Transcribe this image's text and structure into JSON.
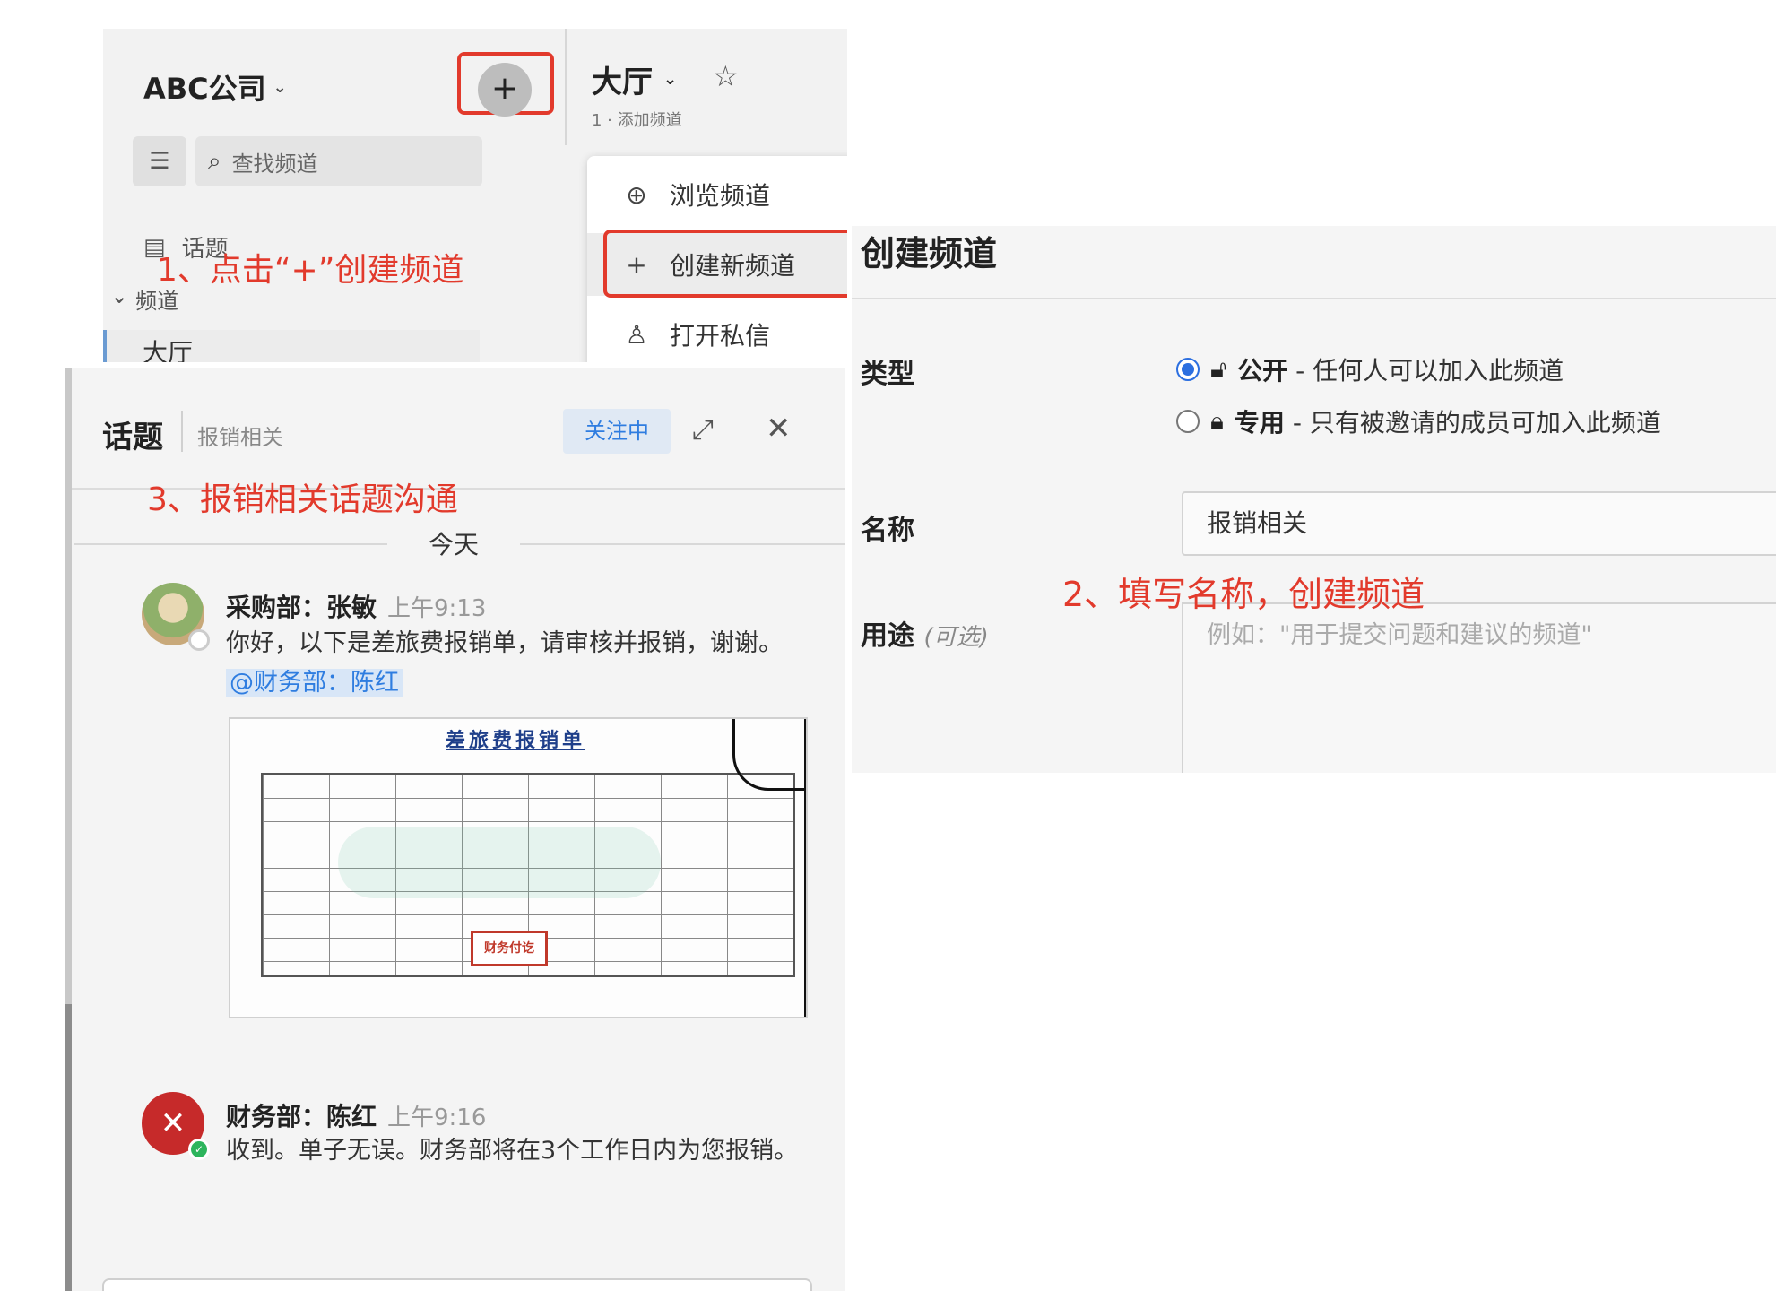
{
  "sidebar": {
    "company": "ABC公司",
    "search_placeholder": "查找频道",
    "topics_label": "话题",
    "section_label": "频道",
    "lobby_label": "大厅"
  },
  "channel_header": {
    "title": "大厅",
    "subinfo": "1 · 添加频道"
  },
  "add_menu": {
    "items": [
      {
        "label": "浏览频道",
        "icon": "globe-icon"
      },
      {
        "label": "创建新频道",
        "icon": "plus-icon"
      },
      {
        "label": "打开私信",
        "icon": "person-icon"
      }
    ]
  },
  "annotations": {
    "step1": "1、点击“+”创建频道",
    "step2": "2、填写名称，创建频道",
    "step3": "3、报销相关话题沟通"
  },
  "create_dialog": {
    "title": "创建频道",
    "type_label": "类型",
    "public_label": "公开",
    "public_desc": " - 任何人可以加入此频道",
    "private_label": "专用",
    "private_desc": " - 只有被邀请的成员可加入此频道",
    "selected_type": "公开",
    "name_label": "名称",
    "name_value": "报销相关",
    "purpose_label": "用途",
    "purpose_optional": "(可选)",
    "purpose_placeholder": "例如：\"用于提交问题和建议的频道\""
  },
  "thread": {
    "title": "话题",
    "subtitle": "报销相关",
    "follow_label": "关注中",
    "day_label": "今天",
    "messages": [
      {
        "sender": "采购部：张敏",
        "time": "上午9:13",
        "text": "你好，以下是差旅费报销单，请审核并报销，谢谢。",
        "mention": "@财务部：陈红",
        "status": "offline"
      },
      {
        "sender": "财务部：陈红",
        "time": "上午9:16",
        "text": "收到。单子无误。财务部将在3个工作日内为您报销。",
        "status": "online"
      }
    ]
  },
  "attachment": {
    "title": "差旅费报销单",
    "stamp": "财务付讫"
  },
  "colors": {
    "annotation_red": "#e23a2c",
    "accent_blue": "#2f7de0",
    "avatar_red": "#c62a2a",
    "online_green": "#2db55d"
  }
}
